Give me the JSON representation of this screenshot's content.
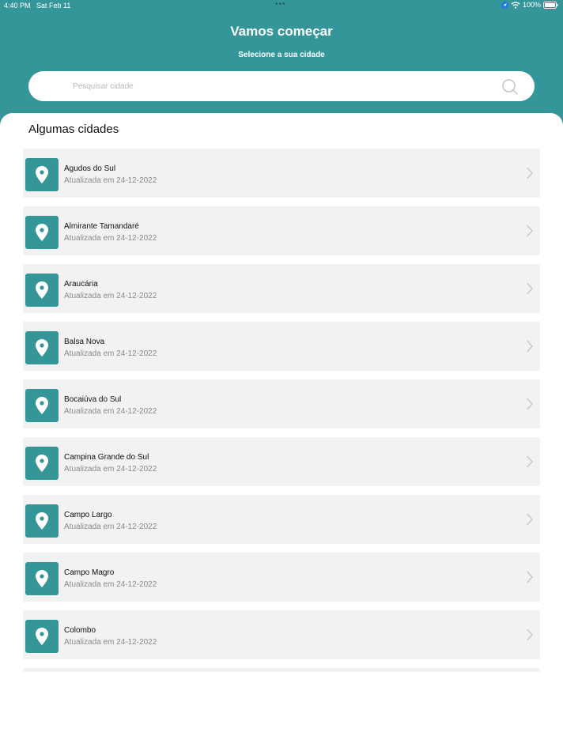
{
  "status_bar": {
    "time": "4:40 PM",
    "date": "Sat Feb 11",
    "dots": "•••",
    "battery": "100%"
  },
  "header": {
    "title": "Vamos começar",
    "subtitle": "Selecione a sua cidade"
  },
  "search": {
    "placeholder": "Pesquisar cidade",
    "value": ""
  },
  "section_title": "Algumas cidades",
  "cities": [
    {
      "name": "Agudos do Sul",
      "updated": "Atualizada em 24-12-2022"
    },
    {
      "name": "Almirante Tamandaré",
      "updated": "Atualizada em 24-12-2022"
    },
    {
      "name": "Araucária",
      "updated": "Atualizada em 24-12-2022"
    },
    {
      "name": "Balsa Nova",
      "updated": "Atualizada em 24-12-2022"
    },
    {
      "name": "Bocaiúva do Sul",
      "updated": "Atualizada em 24-12-2022"
    },
    {
      "name": "Campina Grande do Sul",
      "updated": "Atualizada em 24-12-2022"
    },
    {
      "name": "Campo Largo",
      "updated": "Atualizada em 24-12-2022"
    },
    {
      "name": "Campo Magro",
      "updated": "Atualizada em 24-12-2022"
    },
    {
      "name": "Colombo",
      "updated": "Atualizada em 24-12-2022"
    }
  ],
  "colors": {
    "accent": "#35969a",
    "card_bg": "#f2f2f2"
  }
}
